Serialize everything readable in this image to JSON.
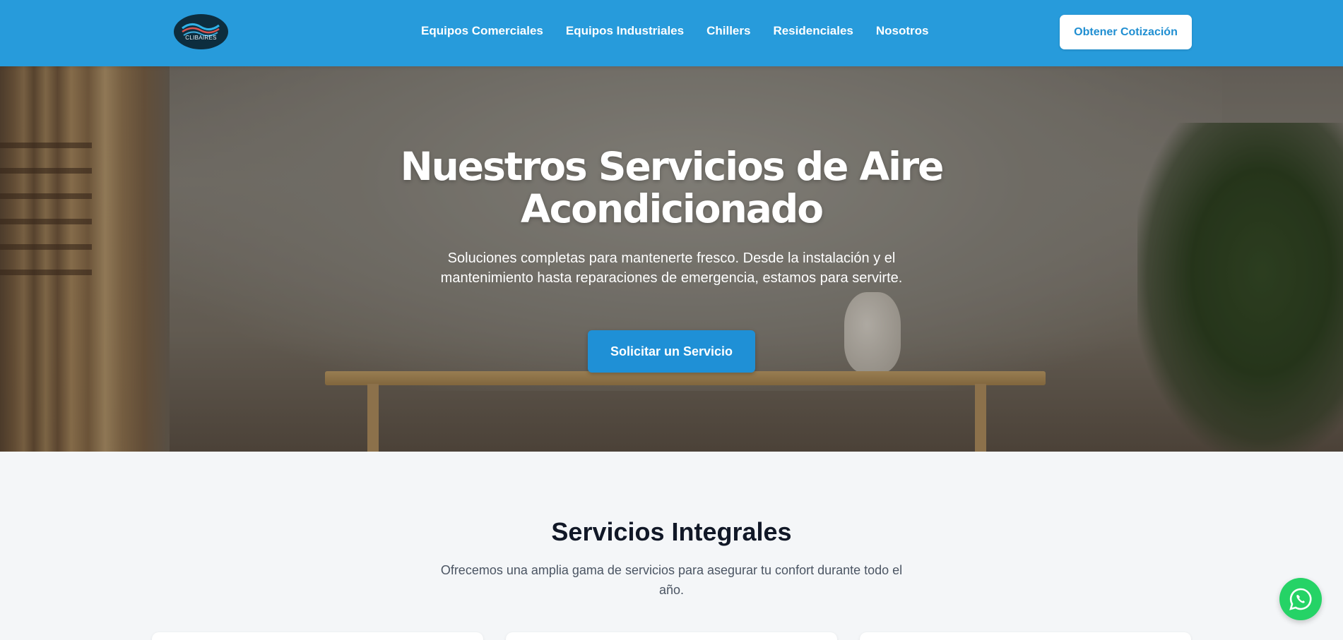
{
  "brand": {
    "logo_text": "CLIBAIRES"
  },
  "nav": {
    "items": [
      {
        "label": "Equipos Comerciales"
      },
      {
        "label": "Equipos Industriales"
      },
      {
        "label": "Chillers"
      },
      {
        "label": "Residenciales"
      },
      {
        "label": "Nosotros"
      }
    ],
    "cta_label": "Obtener Cotización"
  },
  "hero": {
    "title": "Nuestros Servicios de Aire Acondicionado",
    "subtitle": "Soluciones completas para mantenerte fresco. Desde la instalación y el mantenimiento hasta reparaciones de emergencia, estamos para servirte.",
    "button_label": "Solicitar un Servicio"
  },
  "services": {
    "title": "Servicios Integrales",
    "subtitle": "Ofrecemos una amplia gama de servicios para asegurar tu confort durante todo el año."
  },
  "icons": {
    "whatsapp": "whatsapp-icon"
  },
  "colors": {
    "header": "#279bdb",
    "accent": "#1f90d6",
    "whatsapp": "#25d366"
  }
}
